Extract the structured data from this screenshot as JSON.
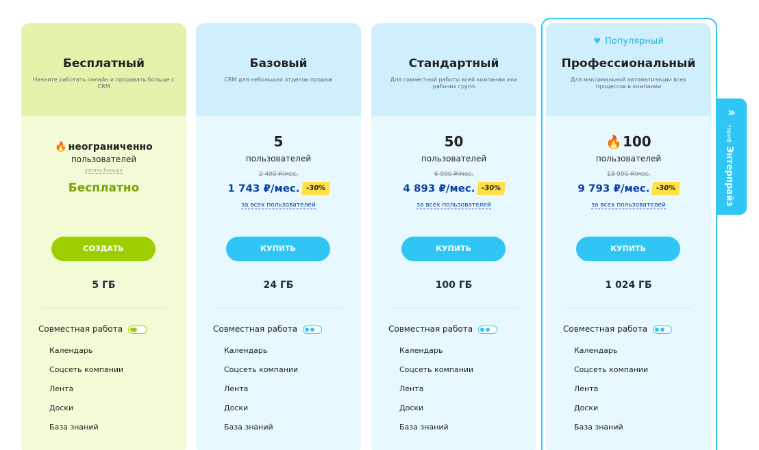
{
  "plans": {
    "free": {
      "title": "Бесплатный",
      "description": "Начните работать онлайн и продавать больше с CRM",
      "users_main": "неограниченно",
      "users_label": "пользователей",
      "learn_more": "узнать больше",
      "price": "Бесплатно",
      "cta": "СОЗДАТЬ",
      "storage": "5 ГБ",
      "feature_group": "Совместная работа",
      "features": [
        "Календарь",
        "Соцсеть компании",
        "Лента",
        "Доски",
        "База знаний"
      ]
    },
    "basic": {
      "title": "Базовый",
      "description": "CRM для небольших отделов продаж",
      "users_count": "5",
      "users_label": "пользователей",
      "old_price": "2 490 ₽/мес.",
      "price": "1 743 ₽/мес.",
      "discount": "-30%",
      "for_all": "за всех пользователей",
      "cta": "КУПИТЬ",
      "storage": "24 ГБ",
      "feature_group": "Совместная работа",
      "features": [
        "Календарь",
        "Соцсеть компании",
        "Лента",
        "Доски",
        "База знаний"
      ]
    },
    "standard": {
      "title": "Стандартный",
      "description": "Для совместной работы всей компании или рабочих групп",
      "users_count": "50",
      "users_label": "пользователей",
      "old_price": "6 990 ₽/мес.",
      "price": "4 893 ₽/мес.",
      "discount": "-30%",
      "for_all": "за всех пользователей",
      "cta": "КУПИТЬ",
      "storage": "100 ГБ",
      "feature_group": "Совместная работа",
      "features": [
        "Календарь",
        "Соцсеть компании",
        "Лента",
        "Доски",
        "База знаний"
      ]
    },
    "pro": {
      "badge": "Популярный",
      "title": "Профессиональный",
      "description": "Для максимальной автоматизации всех процессов в компании",
      "users_count": "100",
      "users_label": "пользователей",
      "old_price": "13 990 ₽/мес.",
      "price": "9 793 ₽/мес.",
      "discount": "-30%",
      "for_all": "за всех пользователей",
      "cta": "КУПИТЬ",
      "storage": "1 024 ГБ",
      "feature_group": "Совместная работа",
      "features": [
        "Календарь",
        "Соцсеть компании",
        "Лента",
        "Доски",
        "База знаний"
      ]
    }
  },
  "enterprise_tab": {
    "sub_label": "тариф",
    "label": "Энтерпрайз"
  },
  "icons": {
    "fire": "fire-icon",
    "heart": "heart-icon",
    "chevron": "double-chevron-right-icon",
    "toggle": "toggle-icon"
  },
  "colors": {
    "free_top": "#e3f3ab",
    "free_body": "#f3fbd6",
    "paid_top": "#cfeffc",
    "paid_body": "#e7f8fe",
    "green_button": "#9dcf00",
    "blue_button": "#2fc6f6",
    "price_blue": "#0a3fa8",
    "free_price_green": "#7aa00c",
    "discount_yellow": "#ffe045",
    "fire_orange": "#ff5e00"
  }
}
